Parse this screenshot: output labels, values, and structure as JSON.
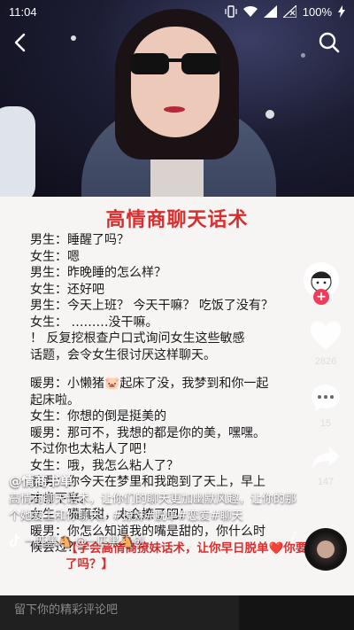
{
  "status_bar": {
    "time": "11:04",
    "battery": "100%"
  },
  "article": {
    "title": "高情商聊天话术",
    "lines": [
      "男生：睡醒了吗？",
      "女生：嗯",
      "男生：昨晚睡的怎么样？",
      "女生：还好吧",
      "男生：今天上班？ 今天干嘛？ 吃饭了没有？",
      "女生：  ………没干嘛。",
      "    ！ 反复挖根查户口式询问女生这些敏感",
      "话题，会令女生很讨厌这样聊天。",
      "",
      "暖男：小懒猪🐷起床了没，我梦到和你一起",
      "  起床啦。",
      "女生：你想的倒是挺美的",
      "暖男：那可不，我想的都是你的美，嘿嘿。",
      "不过你也太粘人了吧！",
      "女生：哦，我怎么粘人了？",
      "暖男：你今天在梦里和我跑到了天上，早上",
      "才肯下来。",
      "女生：嘴真甜，太会撩了吧！",
      "暖男：你怎么知道我的嘴是甜的，你什么时",
      "候尝过？"
    ],
    "promo": "【学会高情商撩妹话术，让你早日脱单❤️你要到了吗？】"
  },
  "actions": {
    "likes": "2826",
    "comments": "15",
    "shares": "147"
  },
  "caption": {
    "author": "@情商书单",
    "description": "高情商聊天话术，让你们的聊天更加幽默风趣，让你的那个她爱上和你聊天。#撩妹#脱单#恋爱#聊天",
    "music": "一匹黑🐴  @一匹黑🐴创"
  },
  "comment_bar": {
    "placeholder": "留下你的精彩评论吧"
  },
  "colors": {
    "title_red": "#d92e2e",
    "follow_red": "#f33a5a"
  }
}
